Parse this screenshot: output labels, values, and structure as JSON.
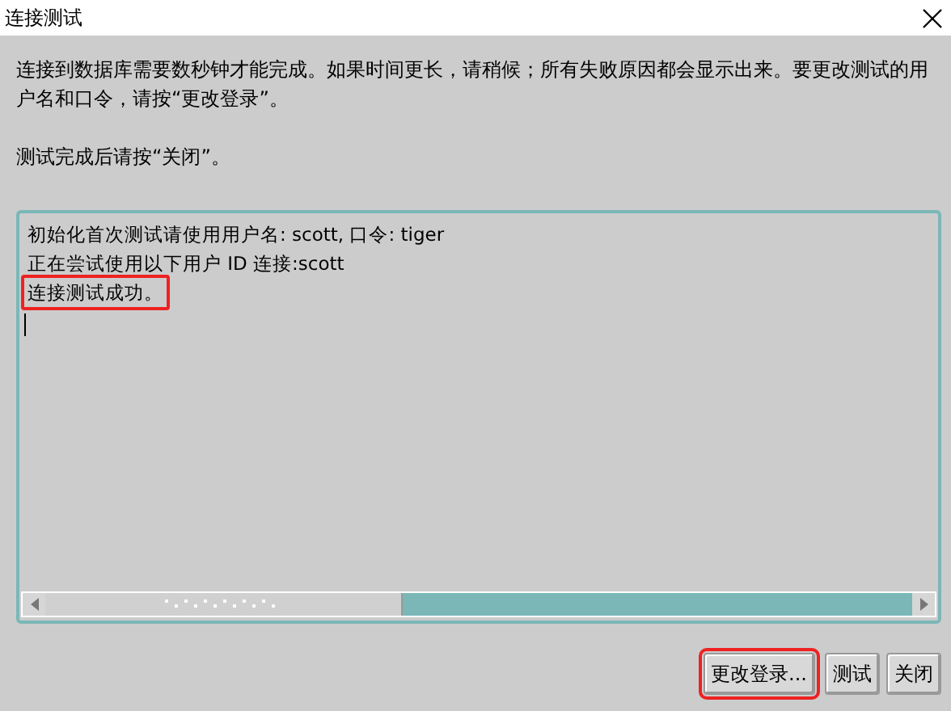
{
  "window": {
    "title": "连接测试"
  },
  "intro": "连接到数据库需要数秒钟才能完成。如果时间更长，请稍候；所有失败原因都会显示出来。要更改测试的用户名和口令，请按“更改登录”。",
  "hint": "测试完成后请按“关闭”。",
  "log_lines": [
    {
      "text": "初始化首次测试请使用用户名: scott, 口令: tiger",
      "highlighted": false
    },
    {
      "text": "正在尝试使用以下用户 ID 连接:scott",
      "highlighted": false
    },
    {
      "text": "连接测试成功。",
      "highlighted": true
    }
  ],
  "buttons": [
    {
      "label": "更改登录...",
      "highlighted": true
    },
    {
      "label": "测试",
      "highlighted": false
    },
    {
      "label": "关闭",
      "highlighted": false
    }
  ]
}
